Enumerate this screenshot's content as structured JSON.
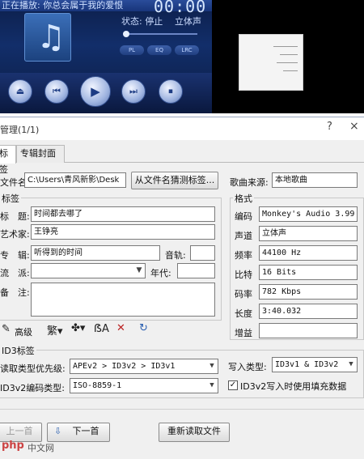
{
  "player": {
    "title": "正在播放: 你总会属于我的爱恨",
    "time": "00:00",
    "state_label": "状态: 停止",
    "sound_mode": "立体声",
    "pills": [
      "PL",
      "EQ",
      "LRC"
    ],
    "note_icon": "music-note-icon",
    "controls": [
      "eject-icon",
      "prev-icon",
      "play-icon",
      "next-icon",
      "stop-icon"
    ]
  },
  "dialog": {
    "title": "管理(1/1)",
    "help": "?",
    "close": "×",
    "tabs": [
      "标签",
      "专辑封面"
    ],
    "filename_label": "文件名:",
    "filename_value": "C:\\Users\\青风新影\\Desk",
    "guess_button": "从文件名猜测标签...",
    "source_label": "歌曲来源:",
    "source_value": "本地歌曲",
    "tag_group": "标签",
    "title_label": "标　题:",
    "title_value": "时间都去哪了",
    "artist_label": "艺术家:",
    "artist_value": "王铮亮",
    "album_label": "专　辑:",
    "album_value": "听得到的时间",
    "track_label": "音轨:",
    "track_value": "",
    "genre_label": "流　派:",
    "genre_value": "",
    "year_label": "年代:",
    "year_value": "",
    "comment_label": "备　注:",
    "comment_value": "",
    "advanced_label": "高级",
    "format_group": "格式",
    "format": {
      "encoding_label": "编码",
      "encoding_value": "Monkey's Audio 3.99",
      "channel_label": "声道",
      "channel_value": "立体声",
      "rate_label": "频率",
      "rate_value": "44100 Hz",
      "bits_label": "比特",
      "bits_value": "16 Bits",
      "bitrate_label": "码率",
      "bitrate_value": "782 Kbps",
      "length_label": "长度",
      "length_value": "3:40.032",
      "gain_label": "增益",
      "gain_value": ""
    },
    "id3_group": "ID3标签",
    "read_priority_label": "读取类型优先级:",
    "read_priority_value": "APEv2 > ID3v2 > ID3v1",
    "write_type_label": "写入类型:",
    "write_type_value": "ID3v1 & ID3v2",
    "encoding_type_label": "ID3v2编码类型:",
    "encoding_type_value": "ISO-8859-1",
    "fill_label": "ID3v2写入时使用填充数据",
    "fill_checked": "✓",
    "prev_button": "上一首",
    "next_button": "下一首",
    "reload_button": "重新读取文件"
  },
  "watermark": {
    "logo": "php",
    "site": "中文网"
  }
}
